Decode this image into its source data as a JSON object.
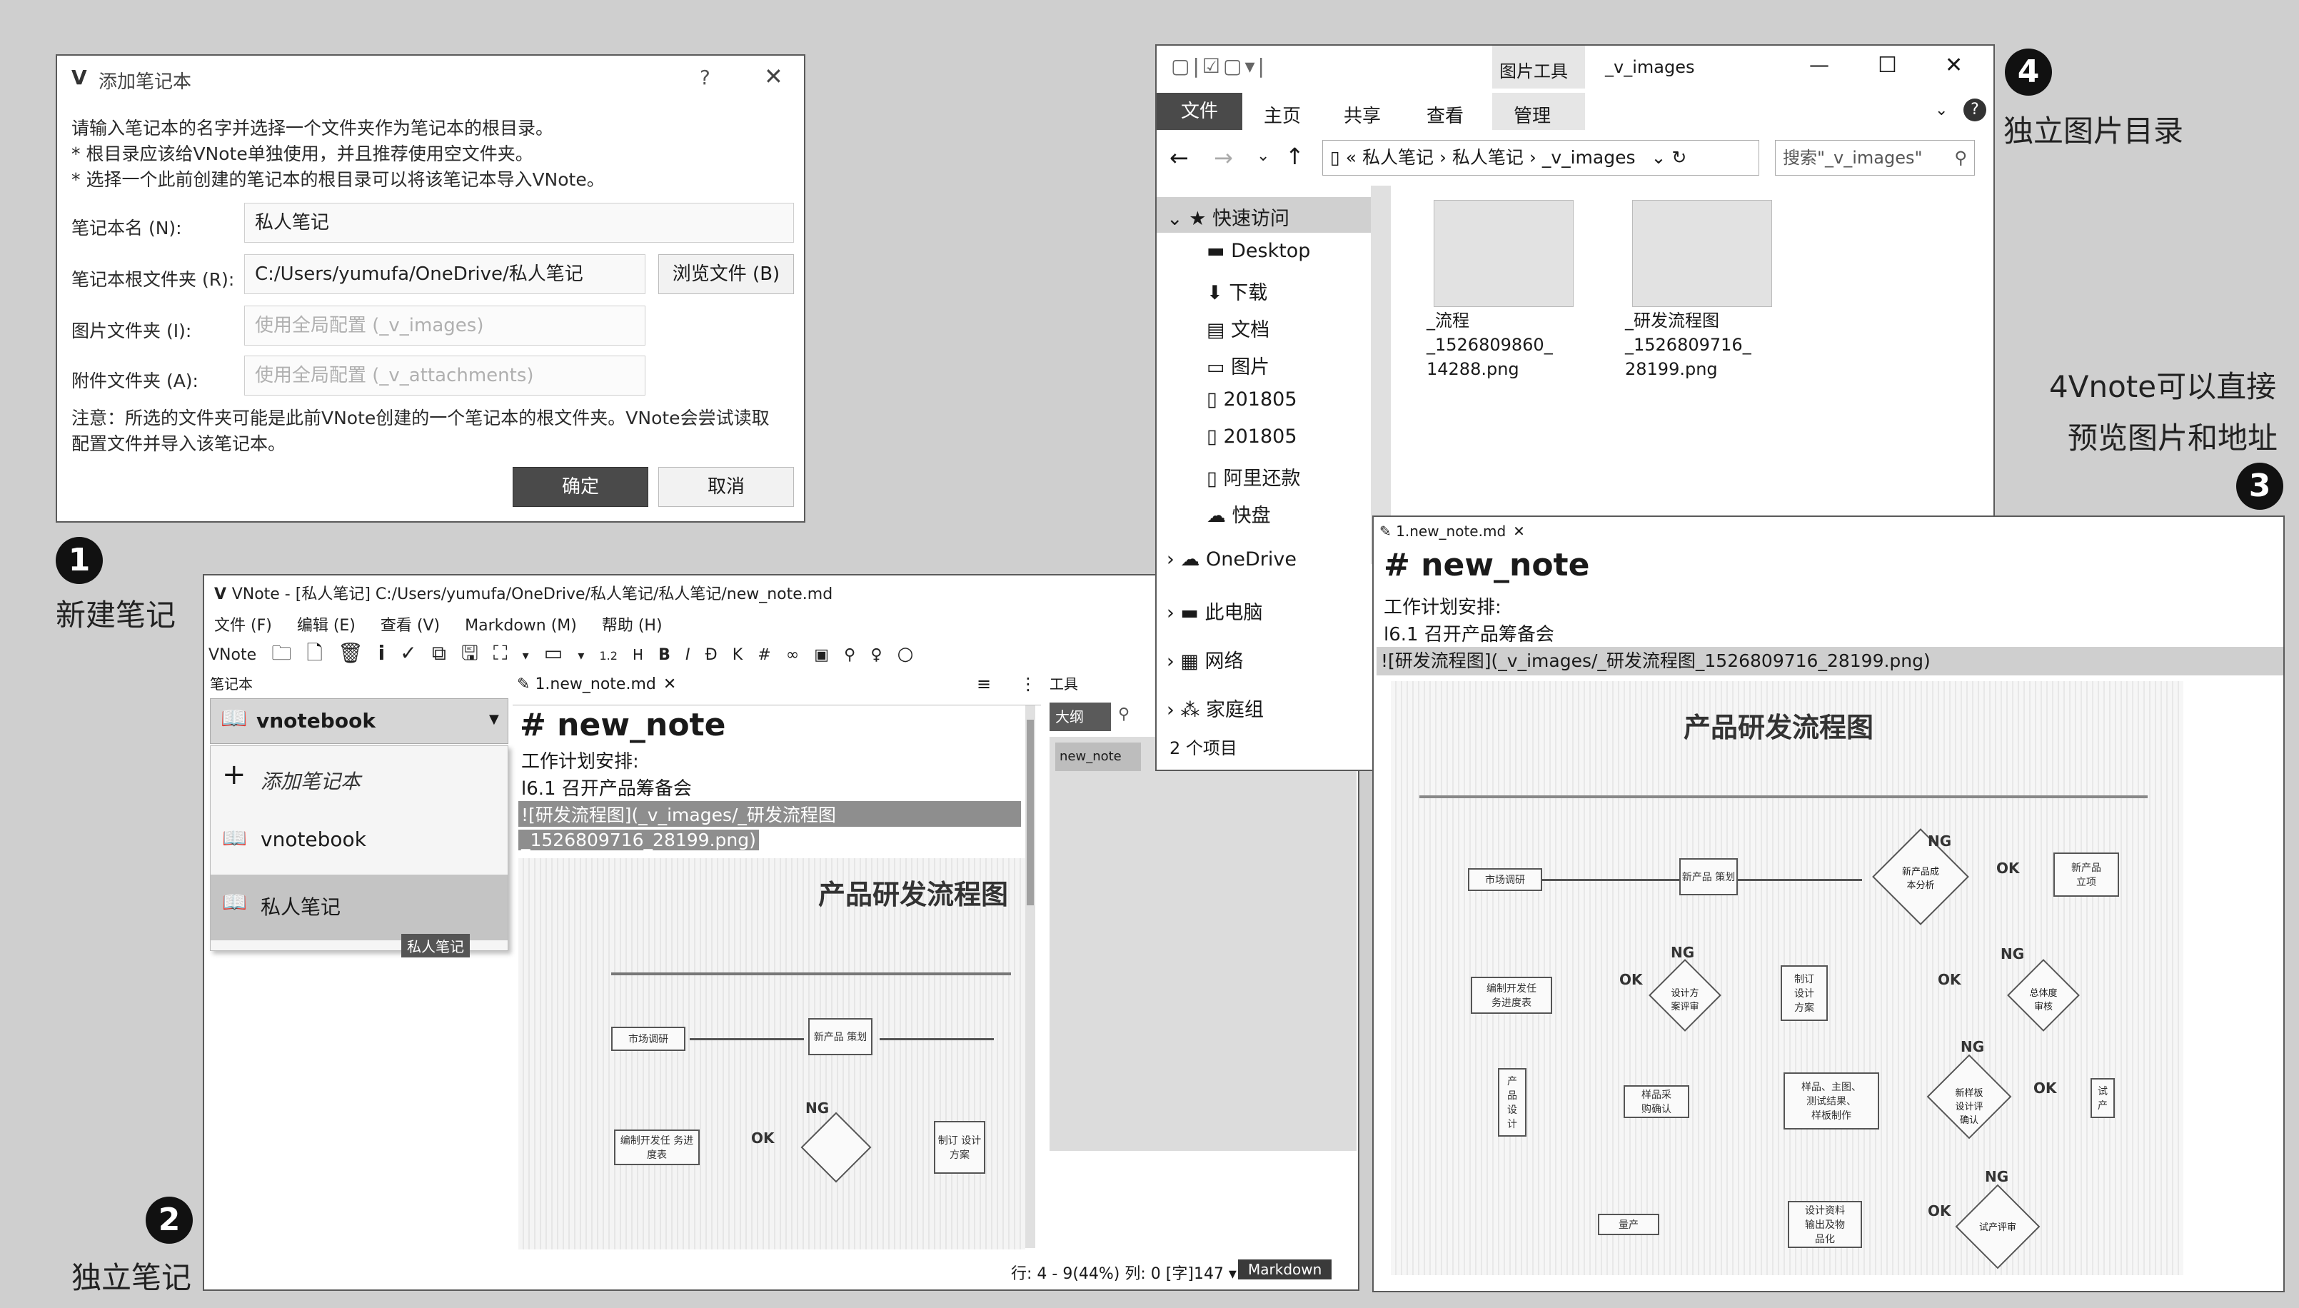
{
  "dialog": {
    "title": "添加笔记本",
    "help": "?",
    "close": "✕",
    "intro": [
      "请输入笔记本的名字并选择一个文件夹作为笔记本的根目录。",
      "* 根目录应该给VNote单独使用，并且推荐使用空文件夹。",
      "* 选择一个此前创建的笔记本的根目录可以将该笔记本导入VNote。"
    ],
    "name_label": "笔记本名 (N):",
    "name_value": "私人笔记",
    "root_label": "笔记本根文件夹 (R):",
    "root_value": "C:/Users/yumufa/OneDrive/私人笔记",
    "browse": "浏览文件 (B)",
    "image_label": "图片文件夹 (I):",
    "image_placeholder": "使用全局配置 (_v_images)",
    "attach_label": "附件文件夹 (A):",
    "attach_placeholder": "使用全局配置 (_v_attachments)",
    "note": [
      "注意：所选的文件夹可能是此前VNote创建的一个笔记本的根文件夹。VNote会尝试读取",
      "配置文件并导入该笔记本。"
    ],
    "ok": "确定",
    "cancel": "取消"
  },
  "callouts": {
    "c1_num": "1",
    "c1_text": "新建笔记",
    "c2_num": "2",
    "c2_text": "独立笔记",
    "c3_num": "3",
    "c3_line1": "4Vnote可以直接",
    "c3_line2": "预览图片和地址",
    "c4_num": "4",
    "c4_text": "独立图片目录"
  },
  "vnote": {
    "title": "VNote - [私人笔记] C:/Users/yumufa/OneDrive/私人笔记/私人笔记/new_note.md",
    "menu": [
      "文件 (F)",
      "编辑 (E)",
      "查看 (V)",
      "Markdown (M)",
      "帮助 (H)"
    ],
    "toolbar_label": "VNote",
    "toolbar_icons": [
      "🗀",
      "🗋",
      "🗑",
      "i",
      "✓",
      "⧉",
      "🖫",
      "⛶",
      "▾",
      "▭",
      "▾",
      "1.2",
      "H",
      "B",
      "I",
      "Đ",
      "K",
      "#",
      "∞",
      "▣",
      "⚲",
      "♀",
      "○"
    ],
    "panel_label": "笔记本",
    "notebook_select": "vnotebook",
    "notebook_items": [
      "添加笔记本",
      "vnotebook",
      "私人笔记"
    ],
    "tooltip": "私人笔记",
    "tab": "1.new_note.md",
    "heading": "# new_note",
    "line1": "工作计划安排:",
    "line2": "l6.1 召开产品筹备会",
    "link1": "![研发流程图](_v_images/_研发流程图",
    "link2": "_1526809716_28199.png)",
    "right_label": "工具",
    "outline_tab": "大纲",
    "outline_item": "new_note",
    "status": "行: 4 - 9(44%) 列: 0  [字]147 ▾",
    "mode": "Markdown"
  },
  "explorer": {
    "tool_tab": "图片工具",
    "title": "_v_images",
    "ribbon": [
      "文件",
      "主页",
      "共享",
      "查看",
      "管理"
    ],
    "path": [
      "«",
      "私人笔记",
      "›",
      "私人笔记",
      "›",
      "_v_images"
    ],
    "search": "搜索\"_v_images\"",
    "nav": [
      "快速访问",
      "Desktop",
      "下载",
      "文档",
      "图片",
      "201805",
      "201805",
      "阿里还款",
      "快盘",
      "OneDrive",
      "此电脑",
      "网络",
      "家庭组"
    ],
    "count": "2 个项目",
    "files": [
      {
        "name": "_流程\n_1526809860_\n14288.png"
      },
      {
        "name": "_研发流程图\n_1526809716_\n28199.png"
      }
    ],
    "min": "—",
    "max": "☐",
    "close": "✕"
  },
  "preview": {
    "tab": "1.new_note.md",
    "heading": "# new_note",
    "line1": "工作计划安排:",
    "line2": "l6.1 召开产品筹备会",
    "link": "![研发流程图](_v_images/_研发流程图_1526809716_28199.png)",
    "image_title": "产品研发流程图",
    "boxes": [
      "市场调研",
      "新产品\n策划",
      "新产品\n立项",
      "编制开发任\n务进度表",
      "设计方\n案评审",
      "制订\n设计\n方案",
      "总体度\n审核",
      "产\n品\n设\n计",
      "样品采\n购确认",
      "样品、主图、\n测试结果、\n样板制作",
      "新样板\n设计评\n确认",
      "试\n产",
      "量产",
      "设计资料\n输出及物\n品化",
      "试产评审"
    ],
    "diamonds": [
      "新产品成\n本分析"
    ],
    "labels": [
      "NG",
      "OK",
      "NG",
      "OK",
      "NG",
      "OK",
      "NG",
      "OK",
      "NG",
      "OK"
    ]
  }
}
